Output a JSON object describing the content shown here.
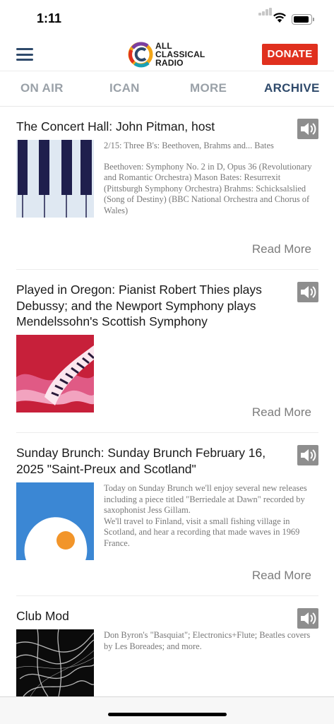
{
  "status": {
    "time": "1:11"
  },
  "header": {
    "logo_text": "ALL CLASSICAL RADIO",
    "logo_lines": [
      "ALL",
      "CLASSICAL",
      "RADIO"
    ],
    "donate": "DONATE"
  },
  "tabs": [
    {
      "label": "ON AIR",
      "active": false
    },
    {
      "label": "ICAN",
      "active": false
    },
    {
      "label": "MORE",
      "active": false
    },
    {
      "label": "ARCHIVE",
      "active": true
    }
  ],
  "colors": {
    "nav_active": "#2f4a6b",
    "nav_inactive": "#9aa1a8",
    "donate_bg": "#e0301e",
    "speaker_bg": "#8e8e8e"
  },
  "archive": [
    {
      "title": "The Concert Hall: John Pitman, host",
      "thumbnail": "piano-keys-icon",
      "desc_lines": [
        "2/15: Three B's: Beethoven, Brahms and... Bates",
        "Beethoven: Symphony No. 2 in D, Opus 36 (Revolutionary and Romantic Orchestra) Mason Bates: Resurrexit (Pittsburgh Symphony Orchestra) Brahms: Schicksalslied (Song of Destiny) (BBC National Orchestra and Chorus of Wales)"
      ],
      "read_more": "Read More"
    },
    {
      "title": "Played in Oregon: Pianist Robert Thies plays Debussy; and the Newport Symphony plays Mendelssohn's Scottish Symphony",
      "thumbnail": "wavy-piano-icon",
      "desc_lines": [],
      "read_more": "Read More"
    },
    {
      "title": "Sunday Brunch: Sunday Brunch February 16, 2025 \"Saint-Preux and Scotland\"",
      "thumbnail": "fried-egg-icon",
      "desc_lines": [
        "Today on Sunday Brunch we'll enjoy several new releases including a piece titled \"Berriedale at Dawn\" recorded by saxophonist Jess Gillam.",
        "We'll travel to Finland, visit a small fishing village in Scotland, and hear a recording that made waves in 1969 France."
      ],
      "read_more": "Read More"
    },
    {
      "title": "Club Mod",
      "thumbnail": "light-swirl-icon",
      "desc_lines": [
        "Don Byron's \"Basquiat\"; Electronics+Flute; Beatles covers by Les Boreades; and more."
      ]
    }
  ]
}
